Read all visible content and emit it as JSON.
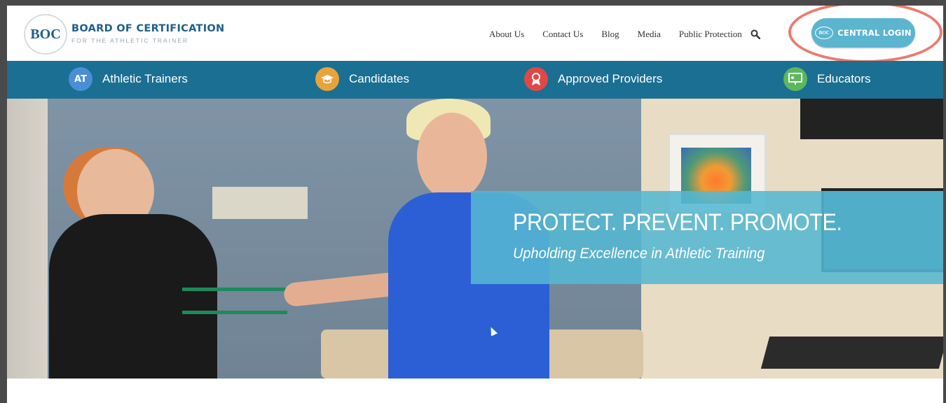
{
  "brand": {
    "logo_mark": "BOC",
    "title": "BOARD OF CERTIFICATION",
    "subtitle": "FOR THE ATHLETIC TRAINER"
  },
  "top_nav": {
    "items": [
      "About Us",
      "Contact Us",
      "Blog",
      "Media",
      "Public Protection"
    ],
    "search_icon": "search-icon"
  },
  "login": {
    "mini_logo": "BOC",
    "label": "CENTRAL LOGIN",
    "highlight_color": "#ec7b6d"
  },
  "categories": [
    {
      "label": "Athletic Trainers",
      "icon": "at-icon",
      "icon_text": "AT",
      "color": "#4a8fd6"
    },
    {
      "label": "Candidates",
      "icon": "graduation-cap-icon",
      "icon_text": "",
      "color": "#e9a33b"
    },
    {
      "label": "Approved Providers",
      "icon": "award-ribbon-icon",
      "icon_text": "",
      "color": "#e04848"
    },
    {
      "label": "Educators",
      "icon": "presentation-board-icon",
      "icon_text": "",
      "color": "#5cb85c"
    }
  ],
  "hero": {
    "headline": "PROTECT. PREVENT. PROMOTE.",
    "subheadline": "Upholding Excellence in Athletic Training"
  },
  "colors": {
    "brand_blue": "#1f5f8a",
    "nav_bar": "#1b6f93",
    "login_button": "#5bb5cf",
    "banner": "#55b7d2"
  }
}
